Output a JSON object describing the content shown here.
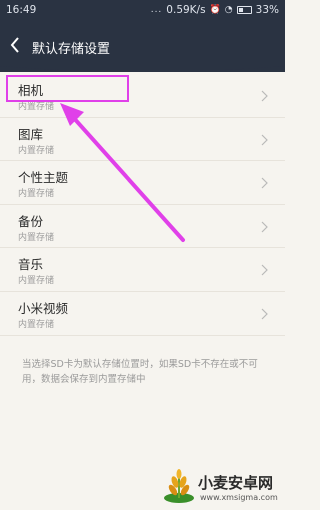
{
  "status_bar": {
    "time": "16:49",
    "network_speed": "0.59K/s",
    "battery": "33%",
    "dots": "..."
  },
  "header": {
    "title": "默认存储设置"
  },
  "storage_items": [
    {
      "label": "相机",
      "sub": "内置存储"
    },
    {
      "label": "图库",
      "sub": "内置存储"
    },
    {
      "label": "个性主题",
      "sub": "内置存储"
    },
    {
      "label": "备份",
      "sub": "内置存储"
    },
    {
      "label": "音乐",
      "sub": "内置存储"
    },
    {
      "label": "小米视频",
      "sub": "内置存储"
    }
  ],
  "footnote": "当选择SD卡为默认存储位置时，如果SD卡不存在或不可用，数据会保存到内置存储中",
  "watermark": {
    "title": "小麦安卓网",
    "url": "www.xmsigma.com"
  },
  "colors": {
    "header_bg": "#2a3342",
    "background": "#f6f4ef",
    "annotation": "#e040e9"
  }
}
